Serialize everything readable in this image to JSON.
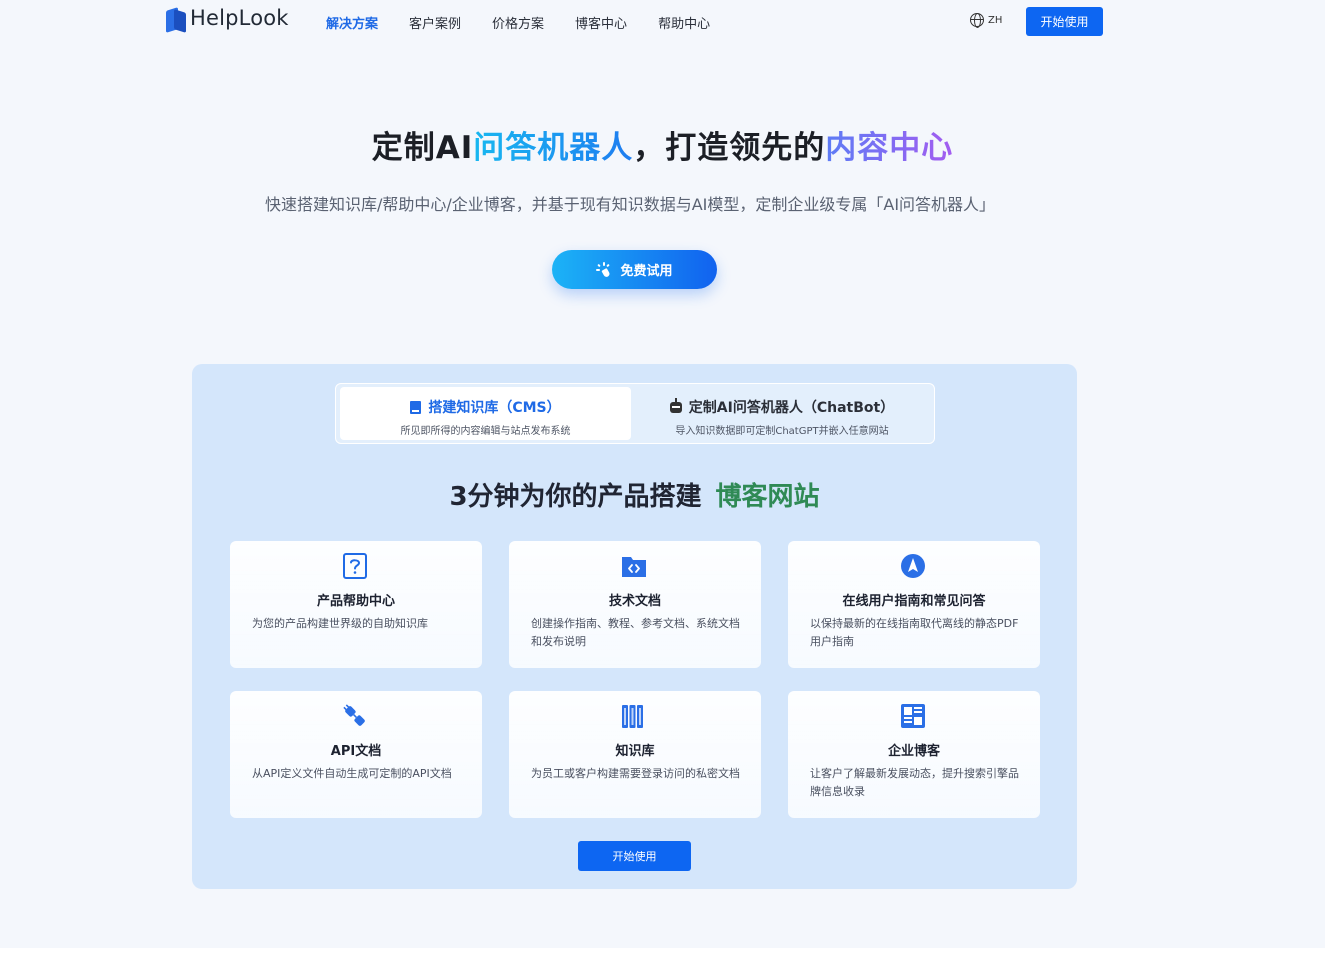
{
  "header": {
    "logo_text": "HelpLook",
    "nav": [
      {
        "label": "解决方案",
        "active": true
      },
      {
        "label": "客户案例",
        "active": false
      },
      {
        "label": "价格方案",
        "active": false
      },
      {
        "label": "博客中心",
        "active": false
      },
      {
        "label": "帮助中心",
        "active": false
      }
    ],
    "lang_label": "ZH",
    "start_button": "开始使用"
  },
  "hero": {
    "title_part1": "定制AI",
    "title_highlight1": "问答机器人",
    "title_part2": "，打造领先的",
    "title_highlight2": "内容中心",
    "subtitle": "快速搭建知识库/帮助中心/企业博客，并基于现有知识数据与AI模型，定制企业级专属「AI问答机器人」",
    "trial_button": "免费试用"
  },
  "tabs": [
    {
      "title": "搭建知识库（CMS）",
      "desc": "所见即所得的内容编辑与站点发布系统",
      "active": true
    },
    {
      "title": "定制AI问答机器人（ChatBot）",
      "desc": "导入知识数据即可定制ChatGPT并嵌入任意网站",
      "active": false
    }
  ],
  "section": {
    "title": "3分钟为你的产品搭建",
    "title_accent": "博客网站"
  },
  "cards": [
    {
      "icon": "question-icon",
      "title": "产品帮助中心",
      "desc": "为您的产品构建世界级的自助知识库"
    },
    {
      "icon": "code-folder-icon",
      "title": "技术文档",
      "desc": "创建操作指南、教程、参考文档、系统文档和发布说明"
    },
    {
      "icon": "compass-icon",
      "title": "在线用户指南和常见问答",
      "desc": "以保持最新的在线指南取代离线的静态PDF用户指南"
    },
    {
      "icon": "plug-icon",
      "title": "API文档",
      "desc": "从API定义文件自动生成可定制的API文档"
    },
    {
      "icon": "books-icon",
      "title": "知识库",
      "desc": "为员工或客户构建需要登录访问的私密文档"
    },
    {
      "icon": "layout-icon",
      "title": "企业博客",
      "desc": "让客户了解最新发展动态，提升搜索引擎品牌信息收录"
    }
  ],
  "bottom_button": "开始使用",
  "colors": {
    "primary": "#0d66f2",
    "panel_bg": "#d4e6fb",
    "accent_green": "#2f8a55"
  }
}
